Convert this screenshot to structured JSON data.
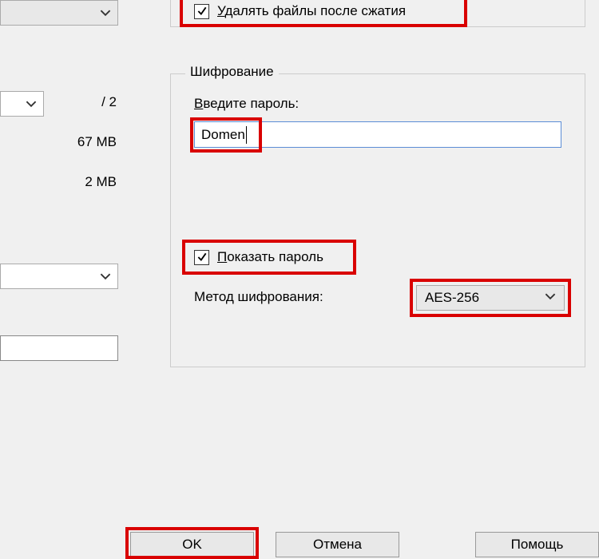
{
  "left": {
    "slash2": "/ 2",
    "size67": "67 MB",
    "size2": "2 MB"
  },
  "top_checkbox": {
    "checked": true,
    "label_pre": "У",
    "label_rest": "далять файлы после сжатия"
  },
  "encryption": {
    "title": "Шифрование",
    "enter_password_pre": "В",
    "enter_password_rest": "ведите пароль:",
    "password_value": "Domen",
    "show_password_pre": "П",
    "show_password_rest": "оказать пароль",
    "method_label": "Метод шифрования:",
    "method_value": "AES-256"
  },
  "buttons": {
    "ok": "OK",
    "cancel": "Отмена",
    "help": "Помощь"
  }
}
